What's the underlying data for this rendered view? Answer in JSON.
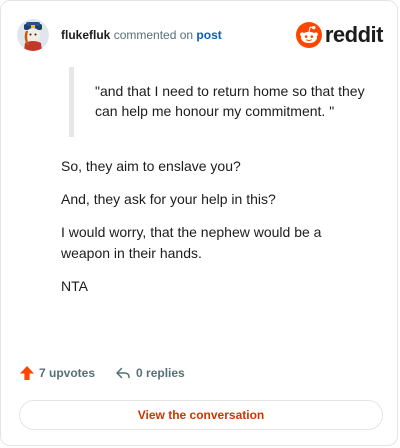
{
  "comment": {
    "username": "flukefluk",
    "action": "commented on",
    "link": "post"
  },
  "brand": {
    "wordmark": "reddit",
    "icon": "reddit-snoo-icon",
    "color": "#ff4500"
  },
  "quote": "\"and that I need to return home so that they can help me honour my commitment. \"",
  "paragraphs": [
    "So, they aim to enslave you?",
    "And, they ask for your help in this?",
    "I would worry, that the nephew would be a weapon in their hands.",
    "NTA"
  ],
  "stats": {
    "upvotes": "7 upvotes",
    "replies": "0 replies"
  },
  "cta": {
    "label": "View the conversation"
  }
}
